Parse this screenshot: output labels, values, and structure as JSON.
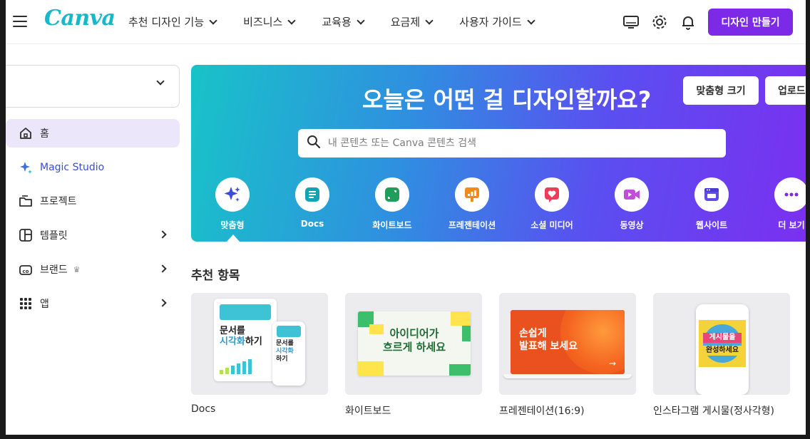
{
  "header": {
    "logo": "Canva",
    "nav": [
      {
        "label": "추천 디자인 기능"
      },
      {
        "label": "비즈니스"
      },
      {
        "label": "교육용"
      },
      {
        "label": "요금제"
      },
      {
        "label": "사용자 가이드"
      }
    ],
    "create_button": "디자인 만들기",
    "brand_color": "#7d2ae8"
  },
  "sidebar": {
    "items": [
      {
        "label": "홈",
        "icon": "home-icon"
      },
      {
        "label": "Magic Studio",
        "icon": "sparkle-icon"
      },
      {
        "label": "프로젝트",
        "icon": "folder-icon"
      },
      {
        "label": "템플릿",
        "icon": "template-icon"
      },
      {
        "label": "브랜드",
        "icon": "brand-icon"
      },
      {
        "label": "앱",
        "icon": "apps-grid-icon"
      }
    ]
  },
  "hero": {
    "title": "오늘은 어떤 걸 디자인할까요?",
    "custom_size_button": "맞춤형 크기",
    "upload_button": "업로드",
    "search_placeholder": "내 콘텐츠 또는 Canva 콘텐츠 검색",
    "categories": [
      {
        "label": "맞춤형",
        "icon": "sparkle-icon",
        "color": "#3b4bd9"
      },
      {
        "label": "Docs",
        "icon": "docs-icon",
        "color": "#13a3b5"
      },
      {
        "label": "화이트보드",
        "icon": "whiteboard-icon",
        "color": "#1e9e5a"
      },
      {
        "label": "프레젠테이션",
        "icon": "presentation-icon",
        "color": "#f18a1c"
      },
      {
        "label": "소셜 미디어",
        "icon": "heart-icon",
        "color": "#ee3b5a"
      },
      {
        "label": "동영상",
        "icon": "video-icon",
        "color": "#c04fd8"
      },
      {
        "label": "웹사이트",
        "icon": "website-icon",
        "color": "#5d4de6"
      },
      {
        "label": "더 보기",
        "icon": "more-icon",
        "color": "#7d2ae8"
      }
    ]
  },
  "recommended": {
    "title": "추천 항목",
    "cards": [
      {
        "title": "Docs",
        "thumb_text_1": "문서를",
        "thumb_text_2": "시각화",
        "thumb_text_3": "하기"
      },
      {
        "title": "화이트보드",
        "thumb_text_1": "아이디어가",
        "thumb_text_2": "흐르게 하세요"
      },
      {
        "title": "프레젠테이션(16:9)",
        "thumb_text_1": "손쉽게",
        "thumb_text_2": "발표해 보세요"
      },
      {
        "title": "인스타그램 게시물(정사각형)",
        "thumb_text_1": "게시물을",
        "thumb_text_2": "완성하세요"
      }
    ]
  }
}
